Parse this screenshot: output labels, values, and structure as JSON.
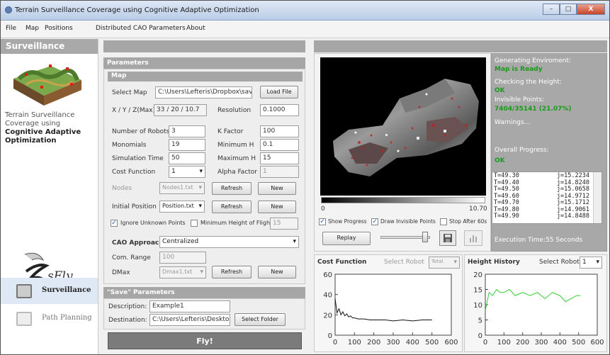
{
  "window": {
    "title": "Terrain Surveillance Coverage using Cognitive Adaptive Optimization",
    "controls": [
      "–",
      "□",
      "X"
    ]
  },
  "menu": [
    "File",
    "Map",
    "Positions",
    "Distributed CAO Parameters",
    "About"
  ],
  "sidebar": {
    "header": "Surveillance",
    "description_lines": [
      "Terrain Surveillance",
      "Coverage using"
    ],
    "description_bold_lines": [
      "Cognitive Adaptive",
      "Optimization"
    ],
    "logo_text": "sFly",
    "nav": [
      {
        "label": "Surveillance",
        "icon": "monitor-icon",
        "active": true
      },
      {
        "label": "Path Planning",
        "icon": "path-planning-icon",
        "active": false
      }
    ]
  },
  "parameters": {
    "header": "Parameters",
    "map": {
      "header": "Map",
      "select_map_label": "Select Map",
      "select_map_value": "C:\\Users\\Lefteris\\Dropbox\\savv",
      "load_file": "Load File",
      "xyz_label": "X / Y / Z(Max)",
      "xyz_value": "33 / 20 / 10.7",
      "resolution_label": "Resolution",
      "resolution_value": "0.1000"
    },
    "fields": {
      "num_robots_label": "Number of Robots",
      "num_robots": "3",
      "k_factor_label": "K Factor",
      "k_factor": "100",
      "monomials_label": "Monomials",
      "monomials": "19",
      "min_h_label": "Minimum H",
      "min_h": "0.1",
      "sim_time_label": "Simulation Time",
      "sim_time": "50",
      "max_h_label": "Maximum H",
      "max_h": "15",
      "cost_fn_label": "Cost Function",
      "cost_fn": "1",
      "alpha_label": "Alpha Factor",
      "alpha": "1"
    },
    "nodes_label": "Nodes",
    "nodes_value": "Nodes1.txt",
    "refresh": "Refresh",
    "new": "New",
    "initial_position_label": "Initial Position",
    "initial_position_value": "Position.txt",
    "ignore_unknown": "Ignore Unknown Points",
    "ignore_unknown_checked": true,
    "min_height_flight": "Minimum Height of Flight",
    "min_height_value": "15",
    "min_height_checked": false,
    "cao_label": "CAO Approach",
    "cao_value": "Centralized",
    "com_range_label": "Com. Range",
    "com_range": "100",
    "dmax_label": "DMax",
    "dmax_value": "Dmax1.txt"
  },
  "save": {
    "header": "\"Save\" Parameters",
    "description_label": "Description:",
    "description": "Example1",
    "destination_label": "Destination:",
    "destination": "C:\\Users\\Lefteris\\Desktop",
    "select_folder": "Select Folder"
  },
  "fly": "Fly!",
  "viewer": {
    "colorbar_min": "0",
    "colorbar_max": "10.70",
    "show_progress": "Show Progress",
    "show_progress_checked": true,
    "draw_invisible": "Draw Invisible Points",
    "draw_invisible_checked": true,
    "stop_after": "Stop After 60s",
    "stop_after_checked": false,
    "replay": "Replay",
    "slider_value": 0.95
  },
  "status": {
    "generating": "Generating Enviroment:",
    "map_ready": "Map is Ready",
    "checking": "Checking the Height:",
    "ok1": "OK",
    "invisible": "Invisible Points:",
    "invisible_value": "7404/35141 (21.07%)",
    "warnings": "Warnings...",
    "overall": "Overall Progress:",
    "ok2": "OK",
    "execution": "Execution Time:55 Seconds",
    "log": [
      [
        "T=49.30",
        "j=15.2234"
      ],
      [
        "T=49.40",
        "j=14.8240"
      ],
      [
        "T=49.50",
        "j=15.0658"
      ],
      [
        "T=49.60",
        "j=14.9712"
      ],
      [
        "T=49.70",
        "j=15.1712"
      ],
      [
        "T=49.80",
        "j=14.9061"
      ],
      [
        "T=49.90",
        "j=14.8488"
      ]
    ]
  },
  "cost_panel": {
    "title": "Cost Function",
    "select_label": "Select Robot",
    "select_value": "Total"
  },
  "height_panel": {
    "title": "Height History",
    "select_label": "Select Robot",
    "select_value": "1"
  },
  "colors": {
    "accent_green": "#1a9a1a",
    "header_gray": "#a6a6a6"
  },
  "chart_data": [
    {
      "type": "line",
      "title": "Cost Function",
      "xlim": [
        0,
        600
      ],
      "ylim": [
        0,
        60
      ],
      "xticks": [
        0,
        100,
        200,
        300,
        400,
        500,
        600
      ],
      "yticks": [
        0,
        20,
        40,
        60
      ],
      "series": [
        {
          "color": "#111111",
          "x": [
            0,
            10,
            20,
            30,
            40,
            50,
            60,
            70,
            80,
            90,
            100,
            120,
            150,
            180,
            220,
            260,
            300,
            350,
            400,
            450,
            500
          ],
          "values": [
            36,
            22,
            26,
            20,
            23,
            19,
            21,
            18,
            19,
            17,
            17,
            16,
            16,
            15,
            15,
            15,
            14,
            15,
            14,
            15,
            15
          ]
        }
      ]
    },
    {
      "type": "line",
      "title": "Height History",
      "xlim": [
        0,
        600
      ],
      "ylim": [
        0,
        20
      ],
      "xticks": [
        0,
        100,
        200,
        300,
        400,
        500,
        600
      ],
      "yticks": [
        0,
        5,
        10,
        15,
        20
      ],
      "series": [
        {
          "color": "#33cc33",
          "x": [
            0,
            10,
            20,
            40,
            60,
            80,
            100,
            130,
            160,
            200,
            240,
            280,
            320,
            360,
            400,
            430,
            460,
            490,
            510
          ],
          "values": [
            8,
            11,
            14,
            13,
            15,
            14,
            14,
            15,
            13,
            14,
            13,
            14,
            12,
            14,
            13,
            11,
            12,
            13,
            13
          ]
        }
      ]
    }
  ]
}
